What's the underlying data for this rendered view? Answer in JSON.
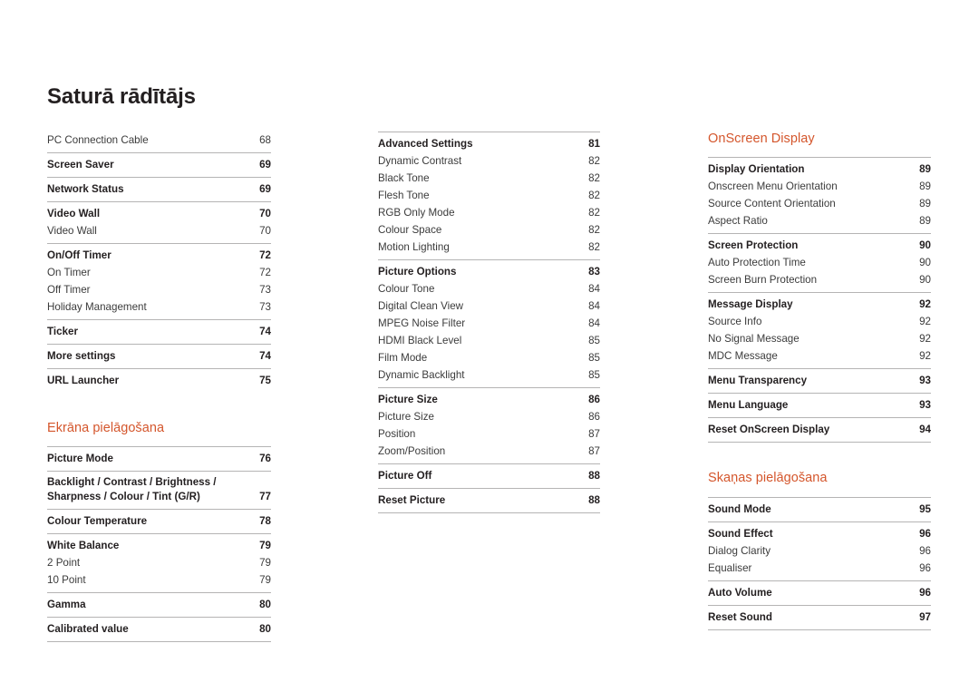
{
  "document": {
    "title": "Saturā rādītājs",
    "accent_color": "#d4562c",
    "text_color": "#231f20",
    "rule_color": "#b5b4b4",
    "background_color": "#ffffff"
  },
  "columns": [
    {
      "id": "column-1",
      "blocks": [
        {
          "type": "group",
          "rule_above": false,
          "entries": [
            {
              "label": "PC Connection Cable",
              "page": "68",
              "level": 2
            }
          ]
        },
        {
          "type": "group",
          "rule_above": true,
          "entries": [
            {
              "label": "Screen Saver",
              "page": "69",
              "level": 1
            }
          ]
        },
        {
          "type": "group",
          "rule_above": true,
          "entries": [
            {
              "label": "Network Status",
              "page": "69",
              "level": 1
            }
          ]
        },
        {
          "type": "group",
          "rule_above": true,
          "entries": [
            {
              "label": "Video Wall",
              "page": "70",
              "level": 1
            },
            {
              "label": "Video Wall",
              "page": "70",
              "level": 2
            }
          ]
        },
        {
          "type": "group",
          "rule_above": true,
          "entries": [
            {
              "label": "On/Off Timer",
              "page": "72",
              "level": 1
            },
            {
              "label": "On Timer",
              "page": "72",
              "level": 2
            },
            {
              "label": "Off Timer",
              "page": "73",
              "level": 2
            },
            {
              "label": "Holiday Management",
              "page": "73",
              "level": 2
            }
          ]
        },
        {
          "type": "group",
          "rule_above": true,
          "entries": [
            {
              "label": "Ticker",
              "page": "74",
              "level": 1
            }
          ]
        },
        {
          "type": "group",
          "rule_above": true,
          "entries": [
            {
              "label": "More settings",
              "page": "74",
              "level": 1
            }
          ]
        },
        {
          "type": "group",
          "rule_above": true,
          "entries": [
            {
              "label": "URL Launcher",
              "page": "75",
              "level": 1
            }
          ]
        },
        {
          "type": "heading",
          "text": "Ekrāna pielāgošana",
          "spaced": true
        },
        {
          "type": "group",
          "rule_above": true,
          "entries": [
            {
              "label": "Picture Mode",
              "page": "76",
              "level": 1
            }
          ]
        },
        {
          "type": "group",
          "rule_above": true,
          "entries": [
            {
              "label": "Backlight / Contrast / Brightness /\nSharpness / Colour / Tint (G/R)",
              "page": "77",
              "level": 1,
              "multiline": true
            }
          ]
        },
        {
          "type": "group",
          "rule_above": true,
          "entries": [
            {
              "label": "Colour Temperature",
              "page": "78",
              "level": 1
            }
          ]
        },
        {
          "type": "group",
          "rule_above": true,
          "entries": [
            {
              "label": "White Balance",
              "page": "79",
              "level": 1
            },
            {
              "label": "2 Point",
              "page": "79",
              "level": 2
            },
            {
              "label": "10 Point",
              "page": "79",
              "level": 2
            }
          ]
        },
        {
          "type": "group",
          "rule_above": true,
          "entries": [
            {
              "label": "Gamma",
              "page": "80",
              "level": 1
            }
          ]
        },
        {
          "type": "group",
          "rule_above": true,
          "rule_below": true,
          "entries": [
            {
              "label": "Calibrated value",
              "page": "80",
              "level": 1
            }
          ]
        }
      ]
    },
    {
      "id": "column-2",
      "blocks": [
        {
          "type": "group",
          "rule_above": true,
          "entries": [
            {
              "label": "Advanced Settings",
              "page": "81",
              "level": 1
            },
            {
              "label": "Dynamic Contrast",
              "page": "82",
              "level": 2
            },
            {
              "label": "Black Tone",
              "page": "82",
              "level": 2
            },
            {
              "label": "Flesh Tone",
              "page": "82",
              "level": 2
            },
            {
              "label": "RGB Only Mode",
              "page": "82",
              "level": 2
            },
            {
              "label": "Colour Space",
              "page": "82",
              "level": 2
            },
            {
              "label": "Motion Lighting",
              "page": "82",
              "level": 2
            }
          ]
        },
        {
          "type": "group",
          "rule_above": true,
          "entries": [
            {
              "label": "Picture Options",
              "page": "83",
              "level": 1
            },
            {
              "label": "Colour Tone",
              "page": "84",
              "level": 2
            },
            {
              "label": "Digital Clean View",
              "page": "84",
              "level": 2
            },
            {
              "label": "MPEG Noise Filter",
              "page": "84",
              "level": 2
            },
            {
              "label": "HDMI Black Level",
              "page": "85",
              "level": 2
            },
            {
              "label": "Film Mode",
              "page": "85",
              "level": 2
            },
            {
              "label": "Dynamic Backlight",
              "page": "85",
              "level": 2
            }
          ]
        },
        {
          "type": "group",
          "rule_above": true,
          "entries": [
            {
              "label": "Picture Size",
              "page": "86",
              "level": 1
            },
            {
              "label": "Picture Size",
              "page": "86",
              "level": 2
            },
            {
              "label": "Position",
              "page": "87",
              "level": 2
            },
            {
              "label": "Zoom/Position",
              "page": "87",
              "level": 2
            }
          ]
        },
        {
          "type": "group",
          "rule_above": true,
          "entries": [
            {
              "label": "Picture Off",
              "page": "88",
              "level": 1
            }
          ]
        },
        {
          "type": "group",
          "rule_above": true,
          "rule_below": true,
          "entries": [
            {
              "label": "Reset Picture",
              "page": "88",
              "level": 1
            }
          ]
        }
      ]
    },
    {
      "id": "column-3",
      "blocks": [
        {
          "type": "heading",
          "text": "OnScreen Display",
          "spaced": false
        },
        {
          "type": "group",
          "rule_above": true,
          "entries": [
            {
              "label": "Display Orientation",
              "page": "89",
              "level": 1
            },
            {
              "label": "Onscreen Menu Orientation",
              "page": "89",
              "level": 2
            },
            {
              "label": "Source Content Orientation",
              "page": "89",
              "level": 2
            },
            {
              "label": "Aspect Ratio",
              "page": "89",
              "level": 2
            }
          ]
        },
        {
          "type": "group",
          "rule_above": true,
          "entries": [
            {
              "label": "Screen Protection",
              "page": "90",
              "level": 1
            },
            {
              "label": "Auto Protection Time",
              "page": "90",
              "level": 2
            },
            {
              "label": "Screen Burn Protection",
              "page": "90",
              "level": 2
            }
          ]
        },
        {
          "type": "group",
          "rule_above": true,
          "entries": [
            {
              "label": "Message Display",
              "page": "92",
              "level": 1
            },
            {
              "label": "Source Info",
              "page": "92",
              "level": 2
            },
            {
              "label": "No Signal Message",
              "page": "92",
              "level": 2
            },
            {
              "label": "MDC Message",
              "page": "92",
              "level": 2
            }
          ]
        },
        {
          "type": "group",
          "rule_above": true,
          "entries": [
            {
              "label": "Menu Transparency",
              "page": "93",
              "level": 1
            }
          ]
        },
        {
          "type": "group",
          "rule_above": true,
          "entries": [
            {
              "label": "Menu Language",
              "page": "93",
              "level": 1
            }
          ]
        },
        {
          "type": "group",
          "rule_above": true,
          "rule_below": true,
          "entries": [
            {
              "label": "Reset OnScreen Display",
              "page": "94",
              "level": 1
            }
          ]
        },
        {
          "type": "heading",
          "text": "Skaņas pielāgošana",
          "spaced": true
        },
        {
          "type": "group",
          "rule_above": true,
          "entries": [
            {
              "label": "Sound Mode",
              "page": "95",
              "level": 1
            }
          ]
        },
        {
          "type": "group",
          "rule_above": true,
          "entries": [
            {
              "label": "Sound Effect",
              "page": "96",
              "level": 1
            },
            {
              "label": "Dialog Clarity",
              "page": "96",
              "level": 2
            },
            {
              "label": "Equaliser",
              "page": "96",
              "level": 2
            }
          ]
        },
        {
          "type": "group",
          "rule_above": true,
          "entries": [
            {
              "label": "Auto Volume",
              "page": "96",
              "level": 1
            }
          ]
        },
        {
          "type": "group",
          "rule_above": true,
          "rule_below": true,
          "entries": [
            {
              "label": "Reset Sound",
              "page": "97",
              "level": 1
            }
          ]
        }
      ]
    }
  ]
}
